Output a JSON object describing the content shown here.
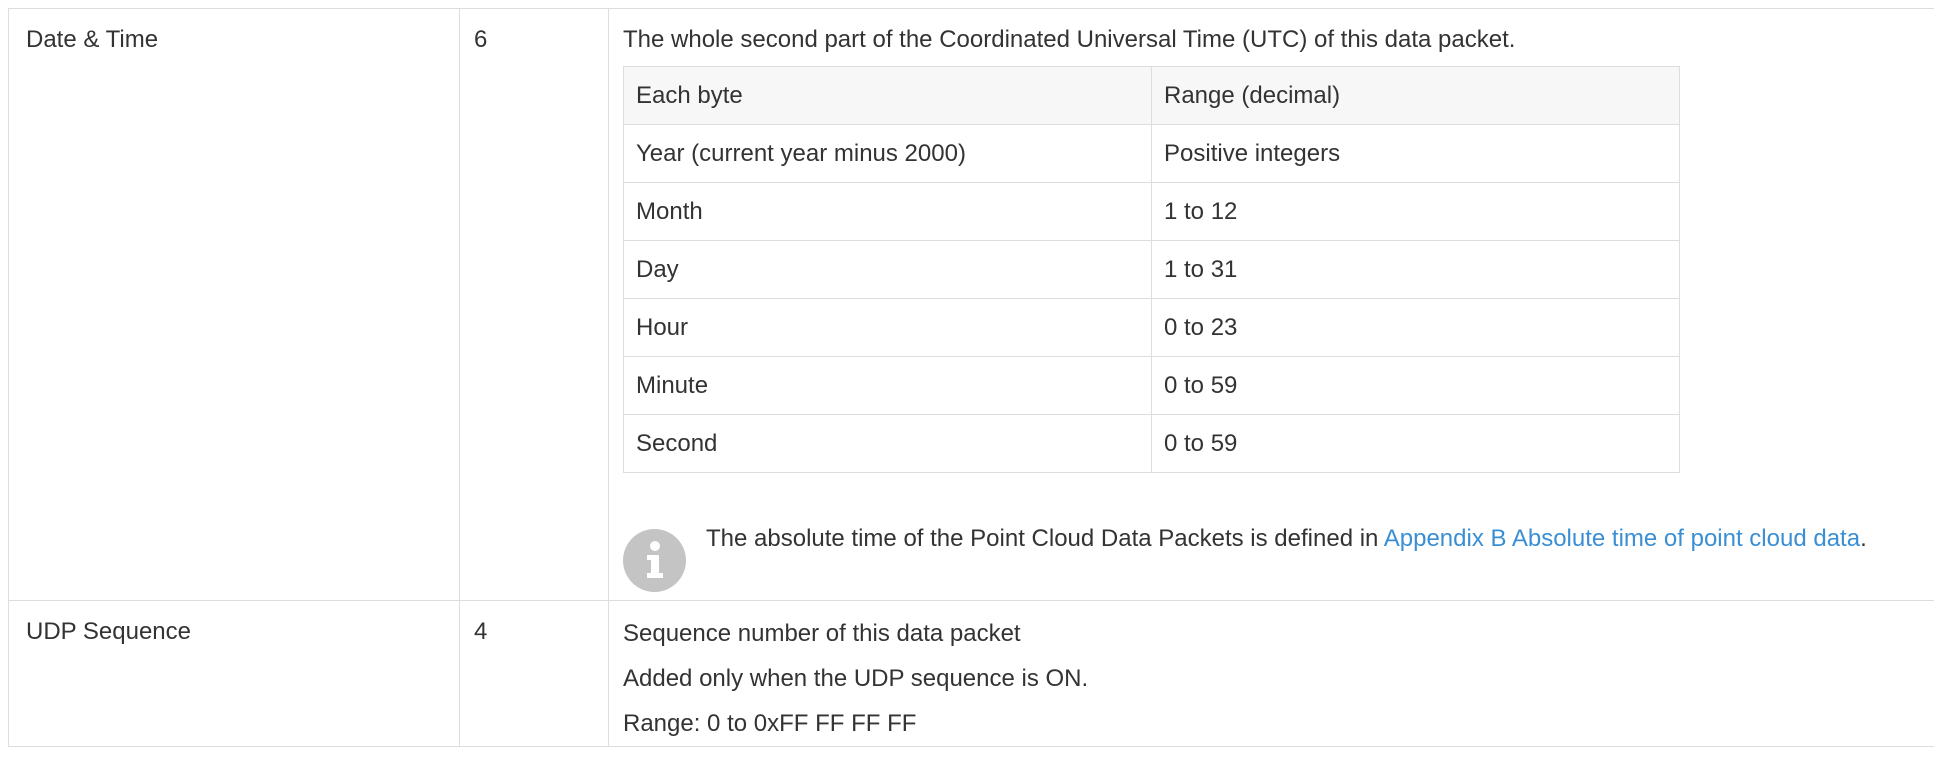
{
  "rows": [
    {
      "name": "Date & Time",
      "size": "6",
      "description": "The whole second part of the Coordinated Universal Time (UTC) of this data packet.",
      "subtable": {
        "headers": [
          "Each byte",
          "Range (decimal)"
        ],
        "rows": [
          [
            "Year (current year minus 2000)",
            "Positive integers"
          ],
          [
            "Month",
            "1 to 12"
          ],
          [
            "Day",
            "1 to 31"
          ],
          [
            "Hour",
            "0 to 23"
          ],
          [
            "Minute",
            "0 to 59"
          ],
          [
            "Second",
            "0 to 59"
          ]
        ]
      },
      "note": {
        "icon": "info-icon",
        "text_before": "The absolute time of the Point Cloud Data Packets is defined in ",
        "link_text": "Appendix B Absolute time of point cloud data",
        "text_after": "."
      }
    },
    {
      "name": "UDP Sequence",
      "size": "4",
      "lines": [
        "Sequence number of this data packet",
        "Added only when the UDP sequence is ON.",
        "Range: 0 to 0xFF FF FF FF"
      ]
    }
  ],
  "colors": {
    "border": "#dddddd",
    "header_bg": "#f7f7f7",
    "link": "#3a8fd4",
    "icon_bg": "#c4c4c4",
    "text": "#333333"
  }
}
